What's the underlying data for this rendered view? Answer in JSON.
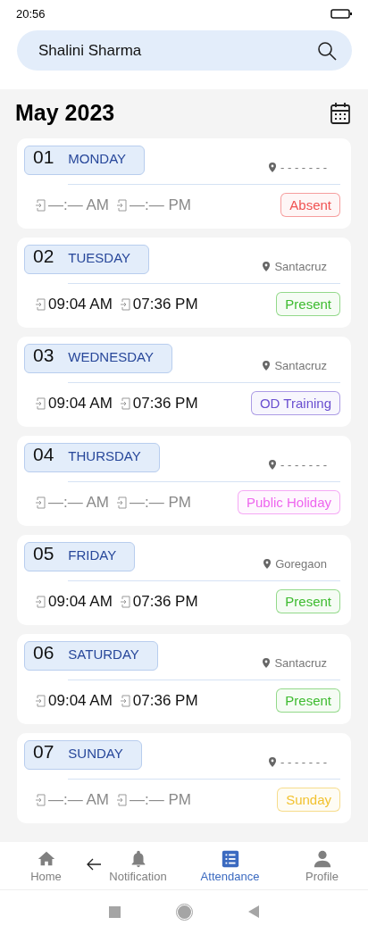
{
  "status_bar": {
    "time": "20:56"
  },
  "search": {
    "value": "Shalini Sharma"
  },
  "month_title": "May 2023",
  "days": [
    {
      "date": "01",
      "weekday": "MONDAY",
      "location": "- - - - - - -",
      "in_time": "—:— AM",
      "out_time": "—:— PM",
      "missing": true,
      "status": "Absent",
      "color": "#f05252"
    },
    {
      "date": "02",
      "weekday": "TUESDAY",
      "location": "Santacruz",
      "in_time": "09:04 AM",
      "out_time": "07:36 PM",
      "missing": false,
      "status": "Present",
      "color": "#3dbb2f"
    },
    {
      "date": "03",
      "weekday": "WEDNESDAY",
      "location": "Santacruz",
      "in_time": "09:04 AM",
      "out_time": "07:36 PM",
      "missing": false,
      "status": "OD Training",
      "color": "#6a4fd0"
    },
    {
      "date": "04",
      "weekday": "THURSDAY",
      "location": "- - - - - - -",
      "in_time": "—:— AM",
      "out_time": "—:— PM",
      "missing": true,
      "status": "Public Holiday",
      "color": "#ee66ee"
    },
    {
      "date": "05",
      "weekday": "FRIDAY",
      "location": "Goregaon",
      "in_time": "09:04 AM",
      "out_time": "07:36 PM",
      "missing": false,
      "status": "Present",
      "color": "#3dbb2f"
    },
    {
      "date": "06",
      "weekday": "SATURDAY",
      "location": "Santacruz",
      "in_time": "09:04 AM",
      "out_time": "07:36 PM",
      "missing": false,
      "status": "Present",
      "color": "#3dbb2f"
    },
    {
      "date": "07",
      "weekday": "SUNDAY",
      "location": "- - - - - - -",
      "in_time": "—:— AM",
      "out_time": "—:— PM",
      "missing": true,
      "status": "Sunday",
      "color": "#f2c230"
    }
  ],
  "nav": [
    {
      "kind": "home",
      "label": "Home",
      "selected": false
    },
    {
      "kind": "bell",
      "label": "Notification",
      "selected": false
    },
    {
      "kind": "list",
      "label": "Attendance",
      "selected": true
    },
    {
      "kind": "person",
      "label": "Profile",
      "selected": false
    }
  ]
}
